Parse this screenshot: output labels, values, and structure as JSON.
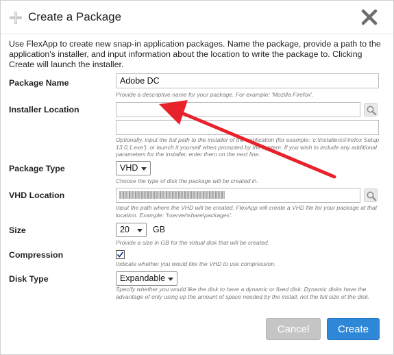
{
  "dialog": {
    "title": "Create a Package",
    "intro": "Use FlexApp to create new snap-in application packages. Name the package, provide a path to the application's installer, and input information about the location to write the package to. Clicking Create will launch the installer."
  },
  "package_name": {
    "label": "Package Name",
    "value": "Adobe DC",
    "hint": "Provide a descriptive name for your package. For example: 'Mozilla Firefox'."
  },
  "installer_location": {
    "label": "Installer Location",
    "value": "",
    "args_value": "",
    "hint": "Optionally, input the full path to the installer of the application (for example: 'c:\\installers\\Firefox Setup 13.0.1.exe'), or launch it yourself when prompted by the system. If you wish to include any additional parameters for the installer, enter them on the next line."
  },
  "package_type": {
    "label": "Package Type",
    "selected": "VHD",
    "hint": "Choose the type of disk the package will be created in."
  },
  "vhd_location": {
    "label": "VHD Location",
    "hint": "Input the path where the VHD will be created. FlexApp will create a VHD file for your package at that location. Example: '\\\\server\\share\\packages'."
  },
  "size": {
    "label": "Size",
    "selected": "20",
    "unit": "GB",
    "hint": "Provide a size in GB for the virtual disk that will be created."
  },
  "compression": {
    "label": "Compression",
    "checked": true,
    "hint": "Indicate whether you would like the VHD to use compression."
  },
  "disk_type": {
    "label": "Disk Type",
    "selected": "Expandable",
    "hint": "Specify whether you would like the disk to have a dynamic or fixed disk. Dynamic disks have the advantage of only using up the amount of space needed by the install, not the full size of the disk."
  },
  "buttons": {
    "cancel": "Cancel",
    "create": "Create"
  },
  "colors": {
    "accent": "#2f87d8",
    "annotation_arrow": "#e8222a"
  },
  "icons": [
    "package-add-icon",
    "close-icon",
    "magnifier-icon",
    "checkmark-icon",
    "dropdown-caret-icon"
  ]
}
